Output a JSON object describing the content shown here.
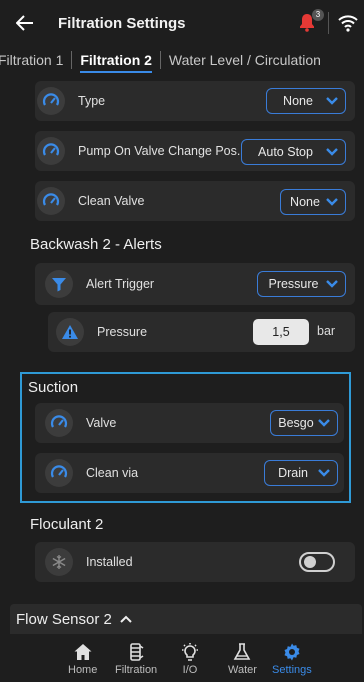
{
  "header": {
    "title": "Filtration Settings",
    "alert_count": "3"
  },
  "tabs": [
    {
      "label": "Filtration 1",
      "active": false
    },
    {
      "label": "Filtration 2",
      "active": true
    },
    {
      "label": "Water Level / Circulation",
      "active": false
    }
  ],
  "valve_rows": [
    {
      "label": "Type",
      "value": "None"
    },
    {
      "label": "Pump On Valve Change Pos.",
      "value": "Auto Stop"
    },
    {
      "label": "Clean Valve",
      "value": "None"
    }
  ],
  "backwash": {
    "title": "Backwash 2 - Alerts",
    "trigger_label": "Alert Trigger",
    "trigger_value": "Pressure",
    "pressure_label": "Pressure",
    "pressure_value": "1,5",
    "pressure_unit": "bar"
  },
  "suction": {
    "title": "Suction",
    "valve_label": "Valve",
    "valve_value": "Besgo",
    "clean_label": "Clean via",
    "clean_value": "Drain"
  },
  "floculant": {
    "title": "Floculant 2",
    "installed_label": "Installed",
    "installed": false
  },
  "flow_sensor": {
    "title": "Flow Sensor 2"
  },
  "nav": [
    {
      "label": "Home",
      "icon": "home-icon",
      "active": false
    },
    {
      "label": "Filtration",
      "icon": "filtration-icon",
      "active": false
    },
    {
      "label": "I/O",
      "icon": "bulb-icon",
      "active": false
    },
    {
      "label": "Water",
      "icon": "flask-icon",
      "active": false
    },
    {
      "label": "Settings",
      "icon": "gear-icon",
      "active": true
    }
  ],
  "colors": {
    "accent": "#3a8be8",
    "suction_border": "#2f9ad6",
    "alert_red": "#e53935",
    "background": "#1e1e1e",
    "card": "#2b2b2b"
  }
}
